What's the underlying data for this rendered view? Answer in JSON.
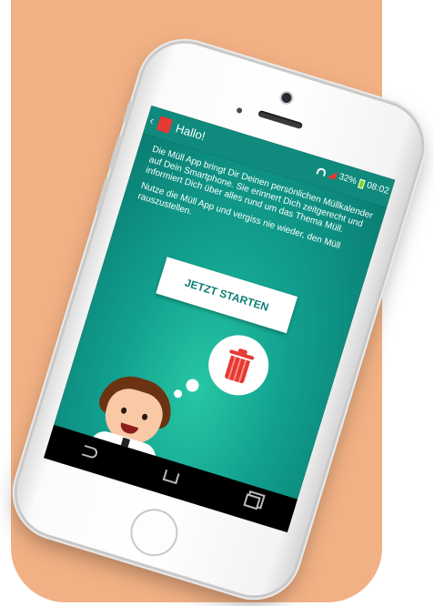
{
  "app": {
    "title": "Hallo!",
    "back_icon": "chevron-left-icon",
    "app_icon": "trash-can-icon"
  },
  "status_bar": {
    "battery_percent": "32%",
    "time": "08:02",
    "wifi_icon": "wifi-icon",
    "signal_icon": "signal-icon",
    "battery_icon": "battery-icon"
  },
  "intro": {
    "paragraph_1": "Die Müll App bringt Dir Deinen persönlichen Müllkalender auf Dein Smartphone. Sie erinnert Dich zeitgerecht und informiert Dich über alles rund um das Thema Müll.",
    "paragraph_2": "Nutze die Müll App und vergiss nie wieder, den Müll rauszustellen."
  },
  "start_button": {
    "label": "JETZT STARTEN"
  },
  "illustration": {
    "bubble_icon": "trash-can-icon",
    "character": "businessman-cartoon"
  },
  "navbar": {
    "back_icon": "back-arrow-icon",
    "home_icon": "home-icon",
    "recents_icon": "recent-apps-icon"
  },
  "colors": {
    "background": "#f2b184",
    "app_bar": "#0f8a7c",
    "content_gradient_center": "#27c7a4",
    "accent_red": "#e53935"
  }
}
